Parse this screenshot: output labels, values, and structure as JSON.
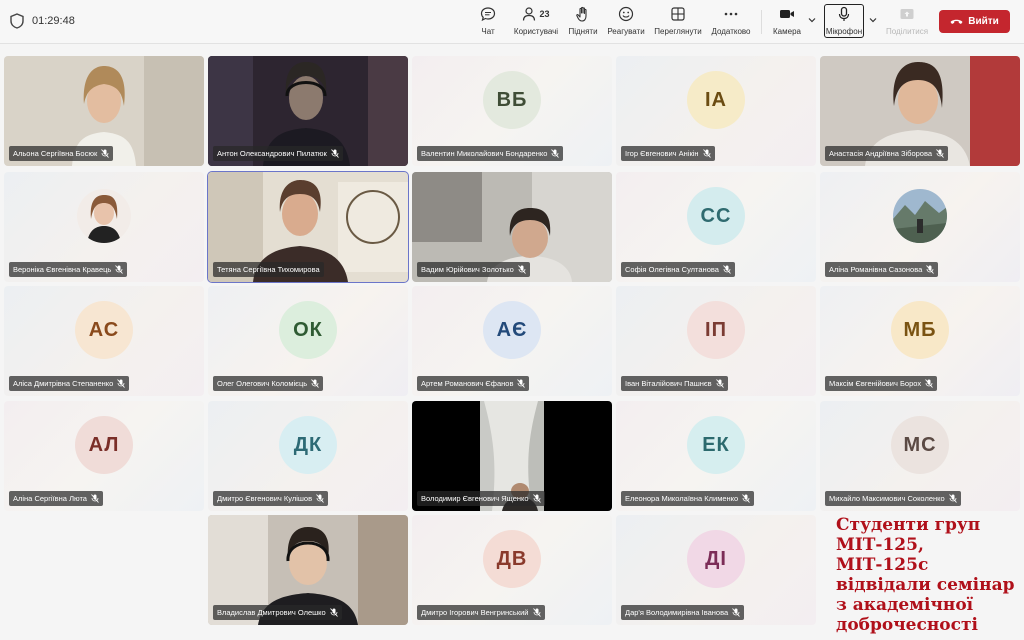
{
  "topbar": {
    "timer": "01:29:48",
    "participants_count": "23",
    "buttons": [
      {
        "label": "Чат",
        "icon": "chat-icon"
      },
      {
        "label": "Користувачі",
        "icon": "people-icon"
      },
      {
        "label": "Підняти",
        "icon": "raise-hand-icon"
      },
      {
        "label": "Реагувати",
        "icon": "smile-icon"
      },
      {
        "label": "Переглянути",
        "icon": "grid-view-icon"
      },
      {
        "label": "Додатково",
        "icon": "more-icon"
      },
      {
        "label": "Камера",
        "icon": "camera-icon"
      },
      {
        "label": "Мікрофон",
        "icon": "microphone-icon"
      },
      {
        "label": "Поділитися",
        "icon": "share-icon"
      }
    ],
    "leave_label": "Вийти"
  },
  "participants": [
    {
      "name": "Альона Сергіївна Босюк",
      "type": "video"
    },
    {
      "name": "Антон Олександрович Пилатюк",
      "type": "video"
    },
    {
      "name": "Валентин Миколайович Бондаренко",
      "initials": "ВБ",
      "avatar_bg": "#e3e9de",
      "avatar_fg": "#3f4d36"
    },
    {
      "name": "Ігор Євгенович Анікін",
      "initials": "ІА",
      "avatar_bg": "#f6ebc8",
      "avatar_fg": "#6b4c12"
    },
    {
      "name": "Анастасія Андріївна Зіборова",
      "type": "video"
    },
    {
      "name": "Вероніка Євгенівна Кравець",
      "type": "photo"
    },
    {
      "name": "Тетяна Сергіївна Тихомирова",
      "type": "video"
    },
    {
      "name": "Вадим Юрійович Золотько",
      "type": "video"
    },
    {
      "name": "Софія Олегівна Султанова",
      "initials": "СС",
      "avatar_bg": "#d4ecee",
      "avatar_fg": "#2f6b70"
    },
    {
      "name": "Аліна Романівна Сазонова",
      "type": "photo"
    },
    {
      "name": "Аліса Дмитрівна Степаненко",
      "initials": "АС",
      "avatar_bg": "#f7e6d2",
      "avatar_fg": "#8a4a1c"
    },
    {
      "name": "Олег Олегович Коломієць",
      "initials": "ОК",
      "avatar_bg": "#dceedd",
      "avatar_fg": "#2f5b33"
    },
    {
      "name": "Артем Романович Єфанов",
      "initials": "АЄ",
      "avatar_bg": "#dde6f3",
      "avatar_fg": "#234a7a"
    },
    {
      "name": "Іван Віталійович Пашнєв",
      "initials": "ІП",
      "avatar_bg": "#f3dfdc",
      "avatar_fg": "#7b3b33"
    },
    {
      "name": "Максім Євгенійович Борох",
      "initials": "МБ",
      "avatar_bg": "#f8e8c8",
      "avatar_fg": "#7a5312"
    },
    {
      "name": "Аліна Сергіївна Люта",
      "initials": "АЛ",
      "avatar_bg": "#f0dcd8",
      "avatar_fg": "#7a2e28"
    },
    {
      "name": "Дмитро Євгенович Кулішов",
      "initials": "ДК",
      "avatar_bg": "#d8eef2",
      "avatar_fg": "#2d6a75"
    },
    {
      "name": "Володимир Євгенович Ященко",
      "type": "video"
    },
    {
      "name": "Елеонора Миколаївна Клименко",
      "initials": "ЕК",
      "avatar_bg": "#d6eeef",
      "avatar_fg": "#2c6a6e"
    },
    {
      "name": "Михайло Максимович Соколенко",
      "initials": "МС",
      "avatar_bg": "#ebe3df",
      "avatar_fg": "#5b4a44"
    },
    {
      "name": "Владислав Дмитрович Олешко",
      "type": "video"
    },
    {
      "name": "Дмитро Ігорович Венгринський",
      "initials": "ДВ",
      "avatar_bg": "#f4dcd5",
      "avatar_fg": "#8a3a2c"
    },
    {
      "name": "Дар'я Володимирівна Іванова",
      "initials": "ДІ",
      "avatar_bg": "#f1d8e6",
      "avatar_fg": "#7c2c57"
    }
  ],
  "caption": [
    "Студенти груп",
    "МІТ-125, МІТ-125с",
    "відвідали семінар",
    "з академічної",
    "доброчесності"
  ],
  "colors": {
    "leave": "#c4262e",
    "active_speaker": "#6b75c9",
    "caption": "#b0101a"
  }
}
